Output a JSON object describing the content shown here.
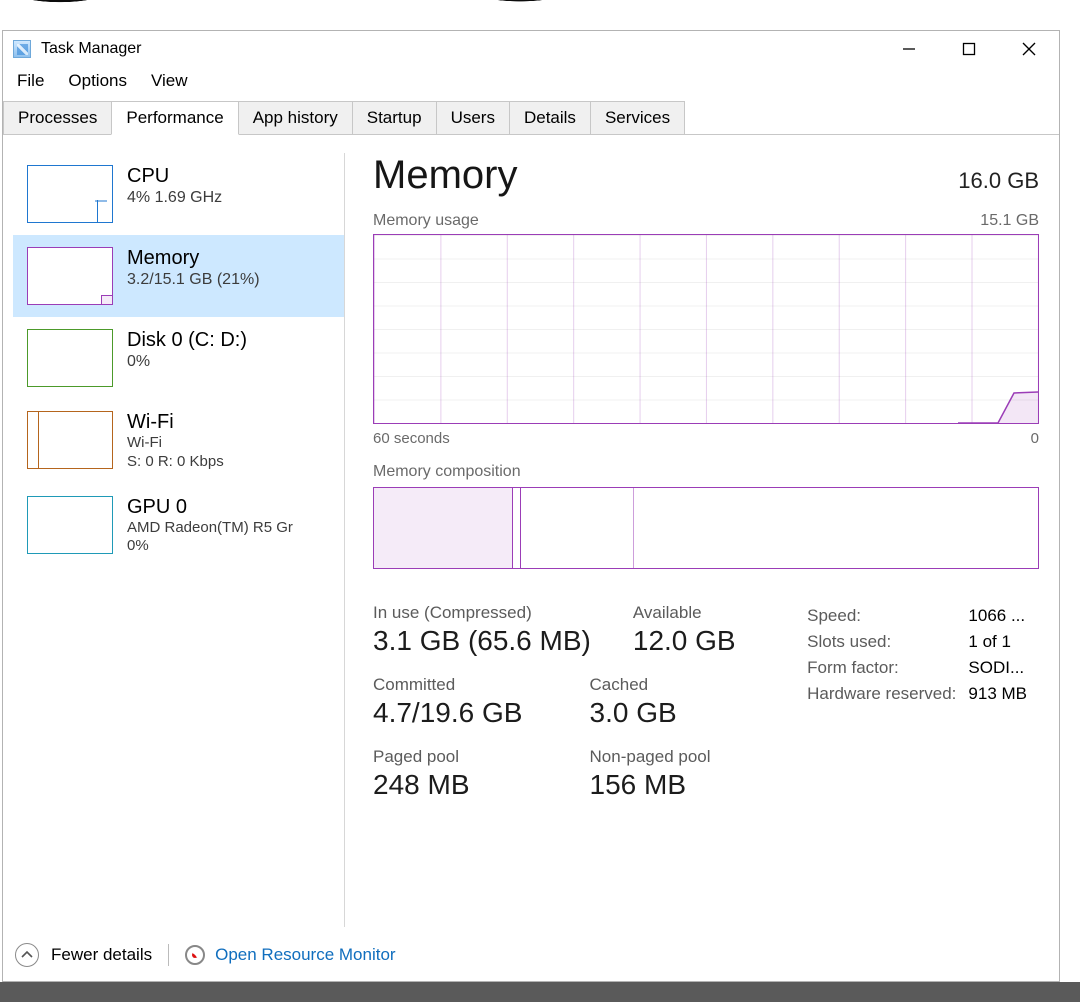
{
  "window": {
    "title": "Task Manager"
  },
  "menu": {
    "file": "File",
    "options": "Options",
    "view": "View"
  },
  "tabs": {
    "processes": "Processes",
    "performance": "Performance",
    "app_history": "App history",
    "startup": "Startup",
    "users": "Users",
    "details": "Details",
    "services": "Services"
  },
  "sidebar": {
    "cpu": {
      "title": "CPU",
      "sub": "4% 1.69 GHz"
    },
    "mem": {
      "title": "Memory",
      "sub": "3.2/15.1 GB (21%)"
    },
    "disk": {
      "title": "Disk 0 (C: D:)",
      "sub": "0%"
    },
    "wifi": {
      "title": "Wi-Fi",
      "sub": "Wi-Fi",
      "sub2": "S: 0 R: 0 Kbps"
    },
    "gpu": {
      "title": "GPU 0",
      "sub": "AMD Radeon(TM) R5 Gr",
      "sub2": "0%"
    }
  },
  "main": {
    "title": "Memory",
    "total": "16.0 GB",
    "usage_label": "Memory usage",
    "usage_max": "15.1 GB",
    "x_left": "60 seconds",
    "x_right": "0",
    "composition_label": "Memory composition",
    "stats": {
      "inuse_label": "In use (Compressed)",
      "inuse_value": "3.1 GB (65.6 MB)",
      "available_label": "Available",
      "available_value": "12.0 GB",
      "committed_label": "Committed",
      "committed_value": "4.7/19.6 GB",
      "cached_label": "Cached",
      "cached_value": "3.0 GB",
      "paged_label": "Paged pool",
      "paged_value": "248 MB",
      "nonpaged_label": "Non-paged pool",
      "nonpaged_value": "156 MB"
    },
    "info": {
      "speed_k": "Speed:",
      "speed_v": "1066 ...",
      "slots_k": "Slots used:",
      "slots_v": "1 of 1",
      "form_k": "Form factor:",
      "form_v": "SODI...",
      "hw_k": "Hardware reserved:",
      "hw_v": "913 MB"
    }
  },
  "footer": {
    "fewer": "Fewer details",
    "rm": "Open Resource Monitor"
  },
  "chart_data": {
    "type": "line",
    "title": "Memory usage",
    "ylabel": "GB",
    "ylim": [
      0,
      15.1
    ],
    "x_seconds_ago": [
      60,
      56,
      52,
      48,
      44,
      40,
      36,
      32,
      28,
      24,
      20,
      16,
      12,
      8,
      4,
      0
    ],
    "values_gb": [
      0,
      0,
      0,
      0,
      0,
      0,
      0,
      0,
      0,
      0,
      0,
      0,
      0,
      2.6,
      3.2,
      3.2
    ],
    "composition": {
      "in_use_gb": 3.1,
      "modified_gb": 0.2,
      "standby_gb": 3.0,
      "free_gb": 8.8,
      "total_gb": 15.1
    }
  }
}
